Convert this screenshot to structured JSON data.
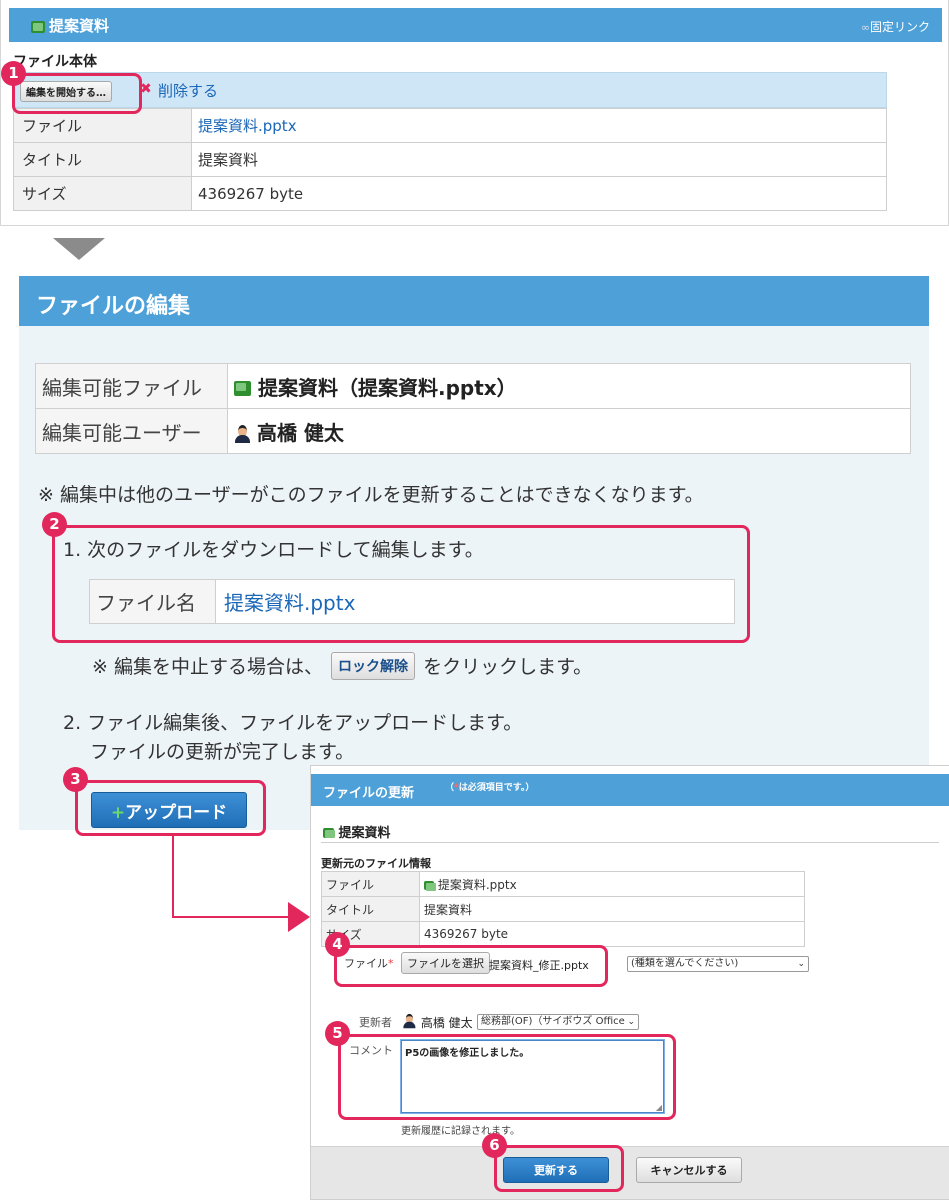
{
  "top": {
    "header_title": "提案資料",
    "permalink_label": "固定リンク",
    "section_label": "ファイル本体",
    "edit_button_label": "編集を開始する…",
    "delete_label": "削除する",
    "rows": [
      {
        "label": "ファイル",
        "value": "提案資料.pptx"
      },
      {
        "label": "タイトル",
        "value": "提案資料"
      },
      {
        "label": "サイズ",
        "value": "4369267 byte"
      }
    ]
  },
  "edit": {
    "header_title": "ファイルの編集",
    "editable_file_label": "編集可能ファイル",
    "editable_file_value": "提案資料（提案資料.pptx）",
    "editable_user_label": "編集可能ユーザー",
    "editable_user_value": "高橋 健太",
    "note": "※ 編集中は他のユーザーがこのファイルを更新することはできなくなります。",
    "step1": "1. 次のファイルをダウンロードして編集します。",
    "filename_label": "ファイル名",
    "filename_value": "提案資料.pptx",
    "cancel_note_prefix": "※ 編集を中止する場合は、",
    "unlock_button": "ロック解除",
    "cancel_note_suffix": "をクリックします。",
    "step2_line1": "2. ファイル編集後、ファイルをアップロードします。",
    "step2_line2": "ファイルの更新が完了します。",
    "upload_button": "アップロード"
  },
  "update": {
    "header_title": "ファイルの更新",
    "required_note": "（",
    "required_mark": "*",
    "required_text": "は必須項目です。）",
    "file_title": "提案資料",
    "source_label": "更新元のファイル情報",
    "rows": [
      {
        "label": "ファイル",
        "value": "提案資料.pptx"
      },
      {
        "label": "タイトル",
        "value": "提案資料"
      },
      {
        "label": "サイズ",
        "value": "4369267 byte"
      }
    ],
    "file_label": "ファイル",
    "choose_button": "ファイルを選択",
    "chosen_file": "提案資料_修正.pptx",
    "type_select": "(種類を選んでください)",
    "updater_label": "更新者",
    "updater_name": "高橋 健太",
    "dept_select": "総務部(OF)（サイボウズ Office",
    "comment_label": "コメント",
    "comment_value": "P5の画像を修正しました。",
    "history_note": "更新履歴に記録されます。",
    "submit_button": "更新する",
    "cancel_button": "キャンセルする"
  },
  "badges": [
    "1",
    "2",
    "3",
    "4",
    "5",
    "6"
  ],
  "colors": {
    "accent": "#e2275c",
    "header_blue": "#4ea0d8",
    "link": "#1a66b8"
  }
}
